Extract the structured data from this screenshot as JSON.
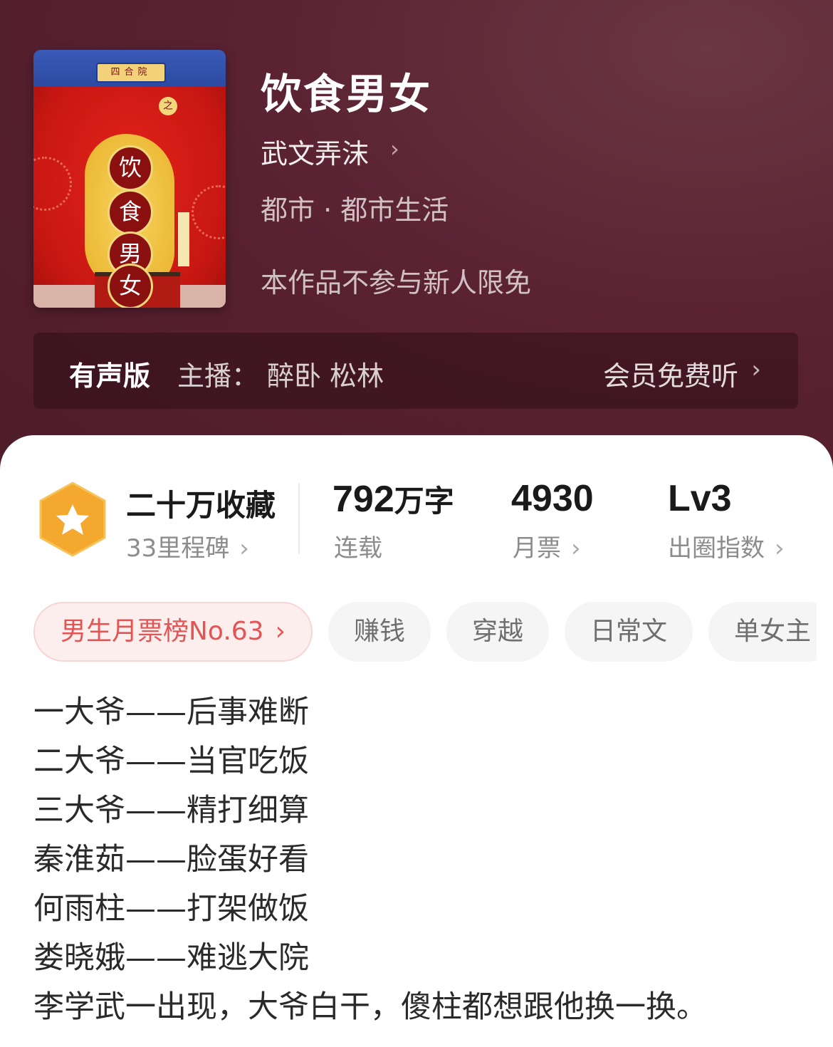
{
  "book": {
    "title": "饮食男女",
    "author": "武文弄沫",
    "category": "都市 · 都市生活",
    "notice": "本作品不参与新人限免"
  },
  "cover": {
    "plaque_text": "四合院",
    "connector_char": "之",
    "title_chars": [
      "饮",
      "食",
      "男",
      "女"
    ]
  },
  "audio": {
    "label": "有声版",
    "host": "主播：  醉卧 松林",
    "cta": "会员免费听"
  },
  "stats": {
    "collect_main": "二十万收藏",
    "collect_sub": "33里程碑",
    "words_num": "792",
    "words_unit": "万字",
    "words_sub": "连载",
    "tickets_num": "4930",
    "tickets_sub": "月票",
    "level_num": "Lv3",
    "level_sub": "出圈指数"
  },
  "tags": [
    "男生月票榜No.63",
    "赚钱",
    "穿越",
    "日常文",
    "单女主"
  ],
  "description": [
    "一大爷——后事难断",
    "二大爷——当官吃饭",
    "三大爷——精打细算",
    "秦淮茹——脸蛋好看",
    "何雨柱——打架做饭",
    "娄晓娥——难逃大院",
    "李学武一出现，大爷白干，傻柱都想跟他换一换。"
  ],
  "colors": {
    "hero_bg": "#5a2232",
    "badge_orange": "#f4a82e",
    "rank_tag_text": "#e35454"
  },
  "icons": {
    "chevron": "›",
    "badge": "star-hexagon-icon"
  }
}
